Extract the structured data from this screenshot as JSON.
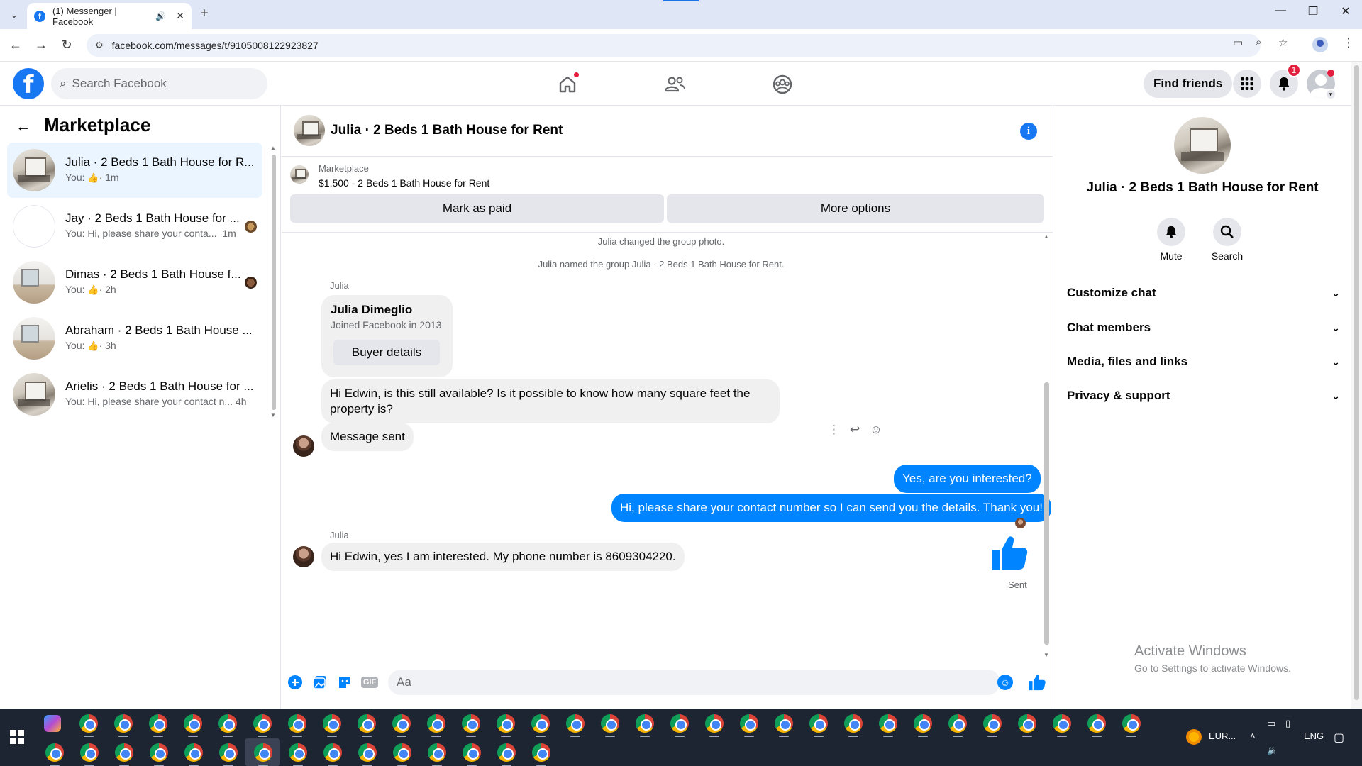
{
  "browser": {
    "tab_title": "(1) Messenger | Facebook",
    "url": "facebook.com/messages/t/9105008122923827",
    "new_tab": "+",
    "tab_close": "✕"
  },
  "header": {
    "search_placeholder": "Search Facebook",
    "find_friends": "Find friends",
    "notification_count": "1",
    "logo_letter": "f"
  },
  "left": {
    "title": "Marketplace",
    "conversations": [
      {
        "name": "Julia · 2 Beds 1 Bath House for R...",
        "snippet_prefix": "You:",
        "snippet": "",
        "time": "· 1m",
        "active": true
      },
      {
        "name": "Jay · 2 Beds 1 Bath House for ...",
        "snippet_prefix": "You:",
        "snippet": "Hi, please share your conta...",
        "time": "1m",
        "active": false
      },
      {
        "name": "Dimas · 2 Beds 1 Bath House f...",
        "snippet_prefix": "You:",
        "snippet": "",
        "time": "· 2h",
        "active": false
      },
      {
        "name": "Abraham · 2 Beds 1 Bath House ...",
        "snippet_prefix": "You:",
        "snippet": "",
        "time": "· 3h",
        "active": false
      },
      {
        "name": "Arielis · 2 Beds 1 Bath House for ...",
        "snippet_prefix": "You:",
        "snippet": "Hi, please share your contact n...",
        "time": "4h",
        "active": false
      }
    ]
  },
  "chat": {
    "title": "Julia · 2 Beds 1 Bath House for Rent",
    "marketplace_label": "Marketplace",
    "listing": "$1,500 - 2 Beds 1 Bath House for Rent",
    "mark_paid": "Mark as paid",
    "more_options": "More options",
    "system_1": "Julia changed the group photo.",
    "system_2": "Julia named the group Julia · 2 Beds 1 Bath House for Rent.",
    "sender_1": "Julia",
    "card_name": "Julia Dimeglio",
    "card_sub": "Joined Facebook in 2013",
    "card_button": "Buyer details",
    "msg_in_1": "Hi Edwin, is this still available? Is it possible to know how many square feet the property is?",
    "msg_in_2": "Message sent",
    "msg_out_1": "Yes, are you interested?",
    "msg_out_2": "Hi, please share your contact number so I can send you the details. Thank you!",
    "sender_2": "Julia",
    "msg_in_3": "Hi Edwin, yes I am interested. My phone number is 8609304220.",
    "sent_label": "Sent",
    "composer_placeholder": "Aa",
    "gif_label": "GIF"
  },
  "right": {
    "title": "Julia · 2 Beds 1 Bath House for Rent",
    "mute": "Mute",
    "search": "Search",
    "rows": [
      "Customize chat",
      "Chat members",
      "Media, files and links",
      "Privacy & support"
    ],
    "activate_1": "Activate Windows",
    "activate_2": "Go to Settings to activate Windows."
  },
  "taskbar": {
    "tray_weather": "EUR...",
    "tray_lang": "ENG"
  },
  "colors": {
    "brand": "#1877f2",
    "outgoing_bubble": "#0084ff",
    "incoming_bubble": "#f0f0f0",
    "badge": "#e41e3f"
  }
}
